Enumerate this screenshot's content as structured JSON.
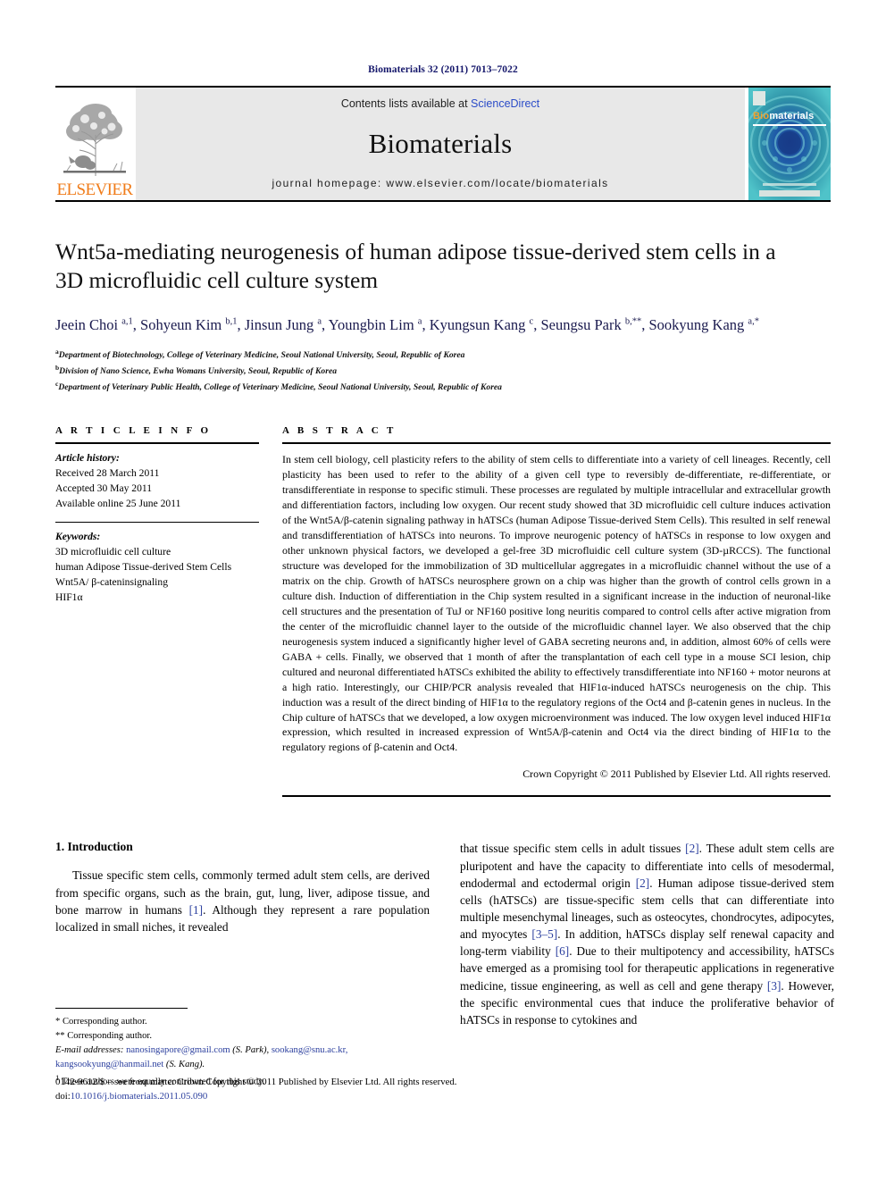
{
  "running_head": "Biomaterials 32 (2011) 7013–7022",
  "masthead": {
    "publisher_name": "ELSEVIER",
    "contents_prefix": "Contents lists available at",
    "contents_link": "ScienceDirect",
    "journal_title": "Biomaterials",
    "homepage": "journal homepage: www.elsevier.com/locate/biomaterials",
    "cover": {
      "bio": "Bio",
      "materials": "materials"
    },
    "link_color": "#2b4cc8",
    "elsevier_orange": "#f07c1a"
  },
  "article": {
    "title": "Wnt5a-mediating neurogenesis of human adipose tissue-derived stem cells in a 3D microfluidic cell culture system",
    "authors_html": "Jeein Choi <sup>a,1</sup>, Sohyeun Kim <sup>b,1</sup>, Jinsun Jung <sup>a</sup>, Youngbin Lim <sup>a</sup>, Kyungsun Kang <sup>c</sup>, Seungsu Park <sup>b,**</sup>, Sookyung Kang <sup>a,*</sup>",
    "affiliations": [
      {
        "mark": "a",
        "text": "Department of Biotechnology, College of Veterinary Medicine, Seoul National University, Seoul, Republic of Korea"
      },
      {
        "mark": "b",
        "text": "Division of Nano Science, Ewha Womans University, Seoul, Republic of Korea"
      },
      {
        "mark": "c",
        "text": "Department of Veterinary Public Health, College of Veterinary Medicine, Seoul National University, Seoul, Republic of Korea"
      }
    ]
  },
  "article_info": {
    "heading": "A R T I C L E   I N F O",
    "history_label": "Article history:",
    "history": [
      "Received 28 March 2011",
      "Accepted 30 May 2011",
      "Available online 25 June 2011"
    ],
    "keywords_label": "Keywords:",
    "keywords": [
      "3D microfluidic cell culture",
      "human Adipose Tissue-derived Stem Cells",
      "Wnt5A/ β-cateninsignaling",
      "HIF1α"
    ]
  },
  "abstract": {
    "heading": "A B S T R A C T",
    "text": "In stem cell biology, cell plasticity refers to the ability of stem cells to differentiate into a variety of cell lineages. Recently, cell plasticity has been used to refer to the ability of a given cell type to reversibly de-differentiate, re-differentiate, or transdifferentiate in response to specific stimuli. These processes are regulated by multiple intracellular and extracellular growth and differentiation factors, including low oxygen. Our recent study showed that 3D microfluidic cell culture induces activation of the Wnt5A/β-catenin signaling pathway in hATSCs (human Adipose Tissue-derived Stem Cells). This resulted in self renewal and transdifferentiation of hATSCs into neurons. To improve neurogenic potency of hATSCs in response to low oxygen and other unknown physical factors, we developed a gel-free 3D microfluidic cell culture system (3D-µRCCS). The functional structure was developed for the immobilization of 3D multicellular aggregates in a microfluidic channel without the use of a matrix on the chip. Growth of hATSCs neurosphere grown on a chip was higher than the growth of control cells grown in a culture dish. Induction of differentiation in the Chip system resulted in a significant increase in the induction of neuronal-like cell structures and the presentation of TuJ or NF160 positive long neuritis compared to control cells after active migration from the center of the microfluidic channel layer to the outside of the microfluidic channel layer. We also observed that the chip neurogenesis system induced a significantly higher level of GABA secreting neurons and, in addition, almost 60% of cells were GABA + cells. Finally, we observed that 1 month of after the transplantation of each cell type in a mouse SCI lesion, chip cultured and neuronal differentiated hATSCs exhibited the ability to effectively transdifferentiate into NF160 + motor neurons at a high ratio. Interestingly, our CHIP/PCR analysis revealed that HIF1α-induced hATSCs neurogenesis on the chip. This induction was a result of the direct binding of HIF1α to the regulatory regions of the Oct4 and β-catenin genes in nucleus. In the Chip culture of hATSCs that we developed, a low oxygen microenvironment was induced. The low oxygen level induced HIF1α expression, which resulted in increased expression of Wnt5A/β-catenin and Oct4 via the direct binding of HIF1α to the regulatory regions of β-catenin and Oct4.",
    "copyright": "Crown Copyright © 2011 Published by Elsevier Ltd. All rights reserved."
  },
  "introduction": {
    "heading": "1.  Introduction",
    "left_paragraph": "Tissue specific stem cells, commonly termed adult stem cells, are derived from specific organs, such as the brain, gut, lung, liver, adipose tissue, and bone marrow in humans [1]. Although they represent a rare population localized in small niches, it revealed",
    "right_paragraph": "that tissue specific stem cells in adult tissues [2]. These adult stem cells are pluripotent and have the capacity to differentiate into cells of mesodermal, endodermal and ectodermal origin [2]. Human adipose tissue-derived stem cells (hATSCs) are tissue-specific stem cells that can differentiate into multiple mesenchymal lineages, such as osteocytes, chondrocytes, adipocytes, and myocytes [3–5]. In addition, hATSCs display self renewal capacity and long-term viability [6]. Due to their multipotency and accessibility, hATSCs have emerged as a promising tool for therapeutic applications in regenerative medicine, tissue engineering, as well as cell and gene therapy [3]. However, the specific environmental cues that induce the proliferative behavior of hATSCs in response to cytokines and"
  },
  "footnotes": {
    "corresponding_single": "* Corresponding author.",
    "corresponding_double": "** Corresponding author.",
    "email_label": "E-mail addresses:",
    "email_1": "nanosingapore@gmail.com",
    "email_1_owner": "(S. Park),",
    "email_2": "sookang@snu.ac.kr,",
    "email_3": "kangsookyung@hanmail.net",
    "email_3_owner": "(S. Kang).",
    "equal_contrib": "These authors were equally contributed for this study.",
    "equal_contrib_mark": "1"
  },
  "footer": {
    "line1": "0142-9612/$ – see front matter Crown Copyright © 2011 Published by Elsevier Ltd. All rights reserved.",
    "doi_label": "doi:",
    "doi_value": "10.1016/j.biomaterials.2011.05.090"
  }
}
